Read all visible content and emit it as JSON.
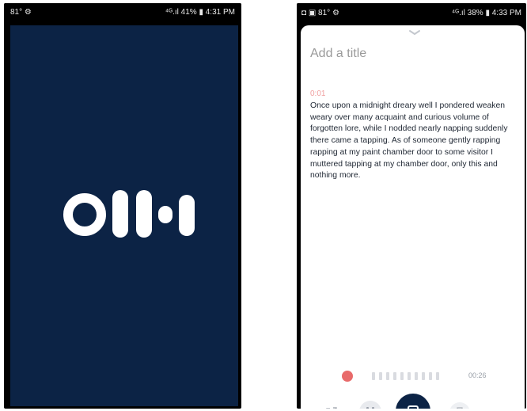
{
  "left_phone": {
    "status_left": "81° ⚙",
    "status_right": "⁴ᴳ.ıl 41% ▮ 4:31 PM"
  },
  "right_phone": {
    "status_left": "◘ ▣ 81° ⚙",
    "status_right": "⁴ᴳ.ıl 38% ▮ 4:33 PM",
    "title_placeholder": "Add a title",
    "timestamp": "0:01",
    "transcript": "Once upon a midnight dreary well I pondered weaken weary over many acquaint and curious volume of forgotten lore, while I nodded nearly napping suddenly there came a tapping. As of someone gently rapping rapping at my paint chamber door to some visitor I muttered tapping at my chamber door, only this and nothing more.",
    "elapsed": "00:26",
    "waveform_ticks": 10,
    "icons": {
      "collapse": "chevron-down-icon",
      "share": "share-icon",
      "pause": "pause-icon",
      "stop": "stop-icon",
      "camera": "camera-icon",
      "recording": "recording-dot-icon"
    }
  },
  "colors": {
    "brand_navy": "#0c2345",
    "record_red": "#e86a6a"
  }
}
